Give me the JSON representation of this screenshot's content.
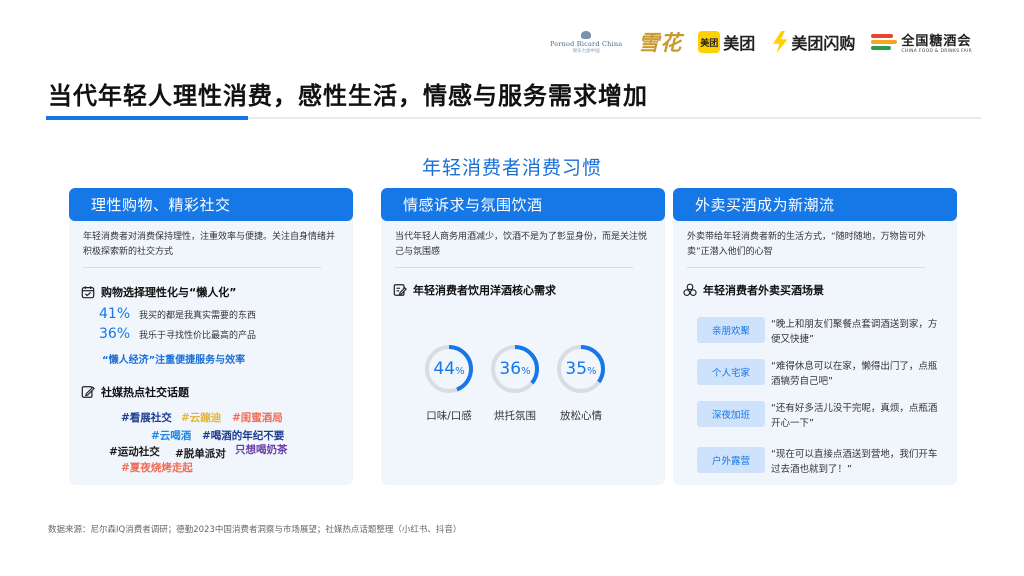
{
  "logos": {
    "pernod": {
      "line1": "Pernod Ricard China",
      "line2": "保乐力加中国"
    },
    "snow": "雪花",
    "meituan": {
      "box": "美团",
      "text": "美团"
    },
    "meituan_flash": "美团闪购",
    "cfdf": {
      "name": "全国糖酒会",
      "sub": "CHINA FOOD & DRINKS FAIR"
    }
  },
  "title": "当代年轻人理性消费，感性生活，情感与服务需求增加",
  "subtitle": "年轻消费者消费习惯",
  "cards": [
    {
      "header": "理性购物、精彩社交",
      "desc": "年轻消费者对消费保持理性，注重效率与便捷。关注自身情绪并积极探索新的社交方式",
      "section1_title": "购物选择理性化与“懒人化”",
      "stats": [
        {
          "value": "41%",
          "text": "我买的都是我真实需要的东西"
        },
        {
          "value": "36%",
          "text": "我乐于寻找性价比最高的产品"
        }
      ],
      "highlight": "“懒人经济”注重便捷服务与效率",
      "section2_title": "社媒热点社交话题",
      "tags": [
        {
          "text": "#看展社交",
          "color": "#1e3d8f"
        },
        {
          "text": "#云蹦迪",
          "color": "#e3b73b"
        },
        {
          "text": "#闺蜜酒局",
          "color": "#ef6e5a"
        },
        {
          "text": "#云喝酒",
          "color": "#1e88e5"
        },
        {
          "text": "#喝酒的年纪不要",
          "color": "#1e3d8f"
        },
        {
          "text": "#运动社交",
          "color": "#1a1a1a"
        },
        {
          "text": "#脱单派对",
          "color": "#1a1a1a"
        },
        {
          "text": "只想喝奶茶",
          "color": "#6a3fa8"
        },
        {
          "text": "#夏夜烧烤走起",
          "color": "#ef6e5a"
        }
      ]
    },
    {
      "header": "情感诉求与氛围饮酒",
      "desc": "当代年轻人商务用酒减少，饮酒不是为了彰显身份，而是关注悦己与氛围感",
      "section1_title": "年轻消费者饮用洋酒核心需求",
      "donuts": [
        {
          "value": 44,
          "label": "口味/口感"
        },
        {
          "value": 36,
          "label": "烘托氛围"
        },
        {
          "value": 35,
          "label": "放松心情"
        }
      ],
      "percent_sign": "%"
    },
    {
      "header": "外卖买酒成为新潮流",
      "desc": "外卖带给年轻消费者新的生活方式，“随时随地，万物皆可外卖”正潜入他们的心智",
      "section1_title": "年轻消费者外卖买酒场景",
      "scenes": [
        {
          "tag": "亲朋欢聚",
          "quote": "“晚上和朋友们聚餐点套调酒送到家，方便又快捷”"
        },
        {
          "tag": "个人宅家",
          "quote": "“难得休息可以在家，懒得出门了，点瓶酒犒劳自己吧”"
        },
        {
          "tag": "深夜加班",
          "quote": "“还有好多活儿没干完呢，真烦，点瓶酒开心一下”"
        },
        {
          "tag": "户外露营",
          "quote": "“现在可以直接点酒送到营地，我们开车过去酒也就到了！”"
        }
      ]
    }
  ],
  "source": "数据来源：尼尔森IQ消费者调研；德勤2023中国消费者洞察与市场展望；社媒热点话题整理（小红书、抖音）",
  "colors": {
    "accent": "#1677e6",
    "card_bg": "#f1f6fd",
    "scene_bg": "#cfe2fb",
    "track": "#d9dde3"
  }
}
